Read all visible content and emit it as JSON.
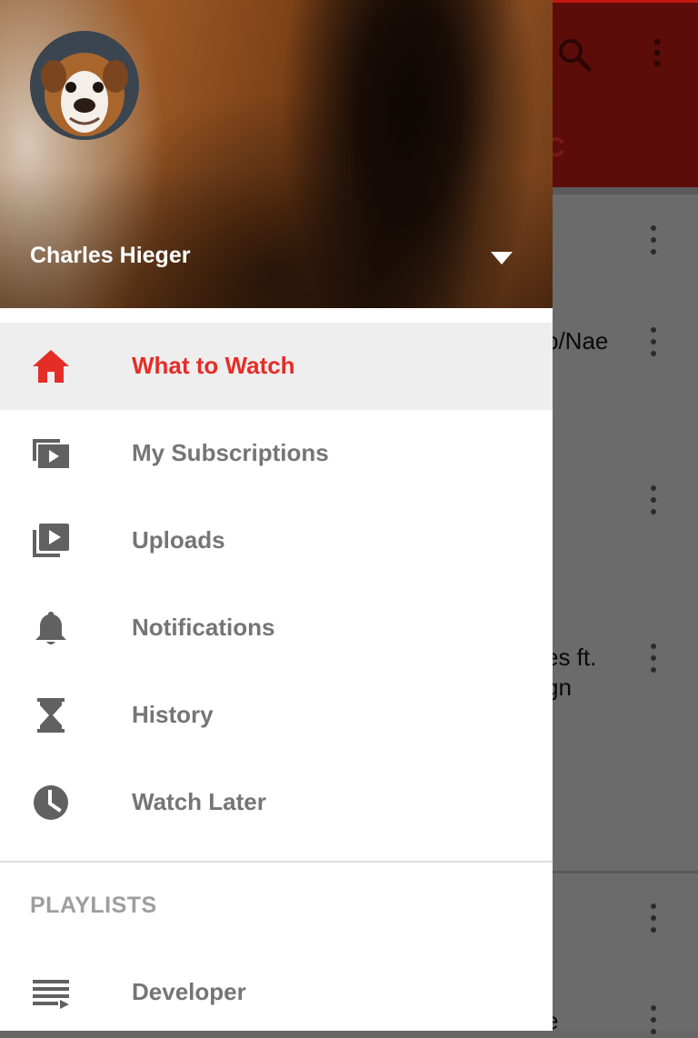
{
  "background": {
    "tab_fragment": "C",
    "list_fragments": [
      {
        "text": "p/Nae"
      },
      {
        "text": "es ft."
      },
      {
        "text": "gn"
      },
      {
        "text": "e"
      }
    ]
  },
  "drawer": {
    "user": {
      "name": "Charles Hieger",
      "avatar_icon": "bulldog-avatar"
    },
    "nav_items": [
      {
        "label": "What to Watch",
        "icon": "home-icon",
        "selected": true
      },
      {
        "label": "My Subscriptions",
        "icon": "subscriptions-icon",
        "selected": false
      },
      {
        "label": "Uploads",
        "icon": "uploads-icon",
        "selected": false
      },
      {
        "label": "Notifications",
        "icon": "bell-icon",
        "selected": false
      },
      {
        "label": "History",
        "icon": "hourglass-icon",
        "selected": false
      },
      {
        "label": "Watch Later",
        "icon": "clock-icon",
        "selected": false
      }
    ],
    "playlists_header": "PLAYLISTS",
    "playlists": [
      {
        "label": "Developer",
        "icon": "playlist-icon"
      }
    ]
  },
  "colors": {
    "accent": "#e52d27",
    "selected_bg": "#eeeeee",
    "icon_gray": "#616161",
    "label_gray": "#757575"
  }
}
